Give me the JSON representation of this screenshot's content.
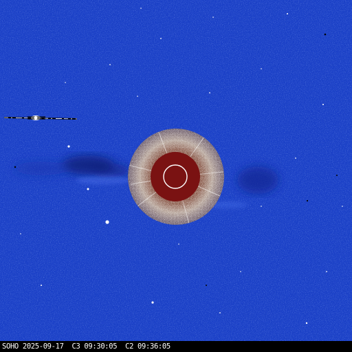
{
  "caption": "SOHO 2025-09-17  C3 09:30:05  C2 09:36:05",
  "colors": {
    "sky": "#1a3fc8",
    "sky_dark": "#1233a8",
    "streamer_dark": "#0c1f7a",
    "occulter_outer": "#c9bfb4",
    "occulter_inner": "#7a1212",
    "sun_outline": "#ffffff",
    "caption_text": "#ffffff",
    "caption_bg": "#000000"
  },
  "features": [
    "lasco-c3-field",
    "lasco-c2-inset",
    "occulting-disk",
    "solar-limb-circle",
    "ccd-bleed-streak",
    "star-field"
  ]
}
